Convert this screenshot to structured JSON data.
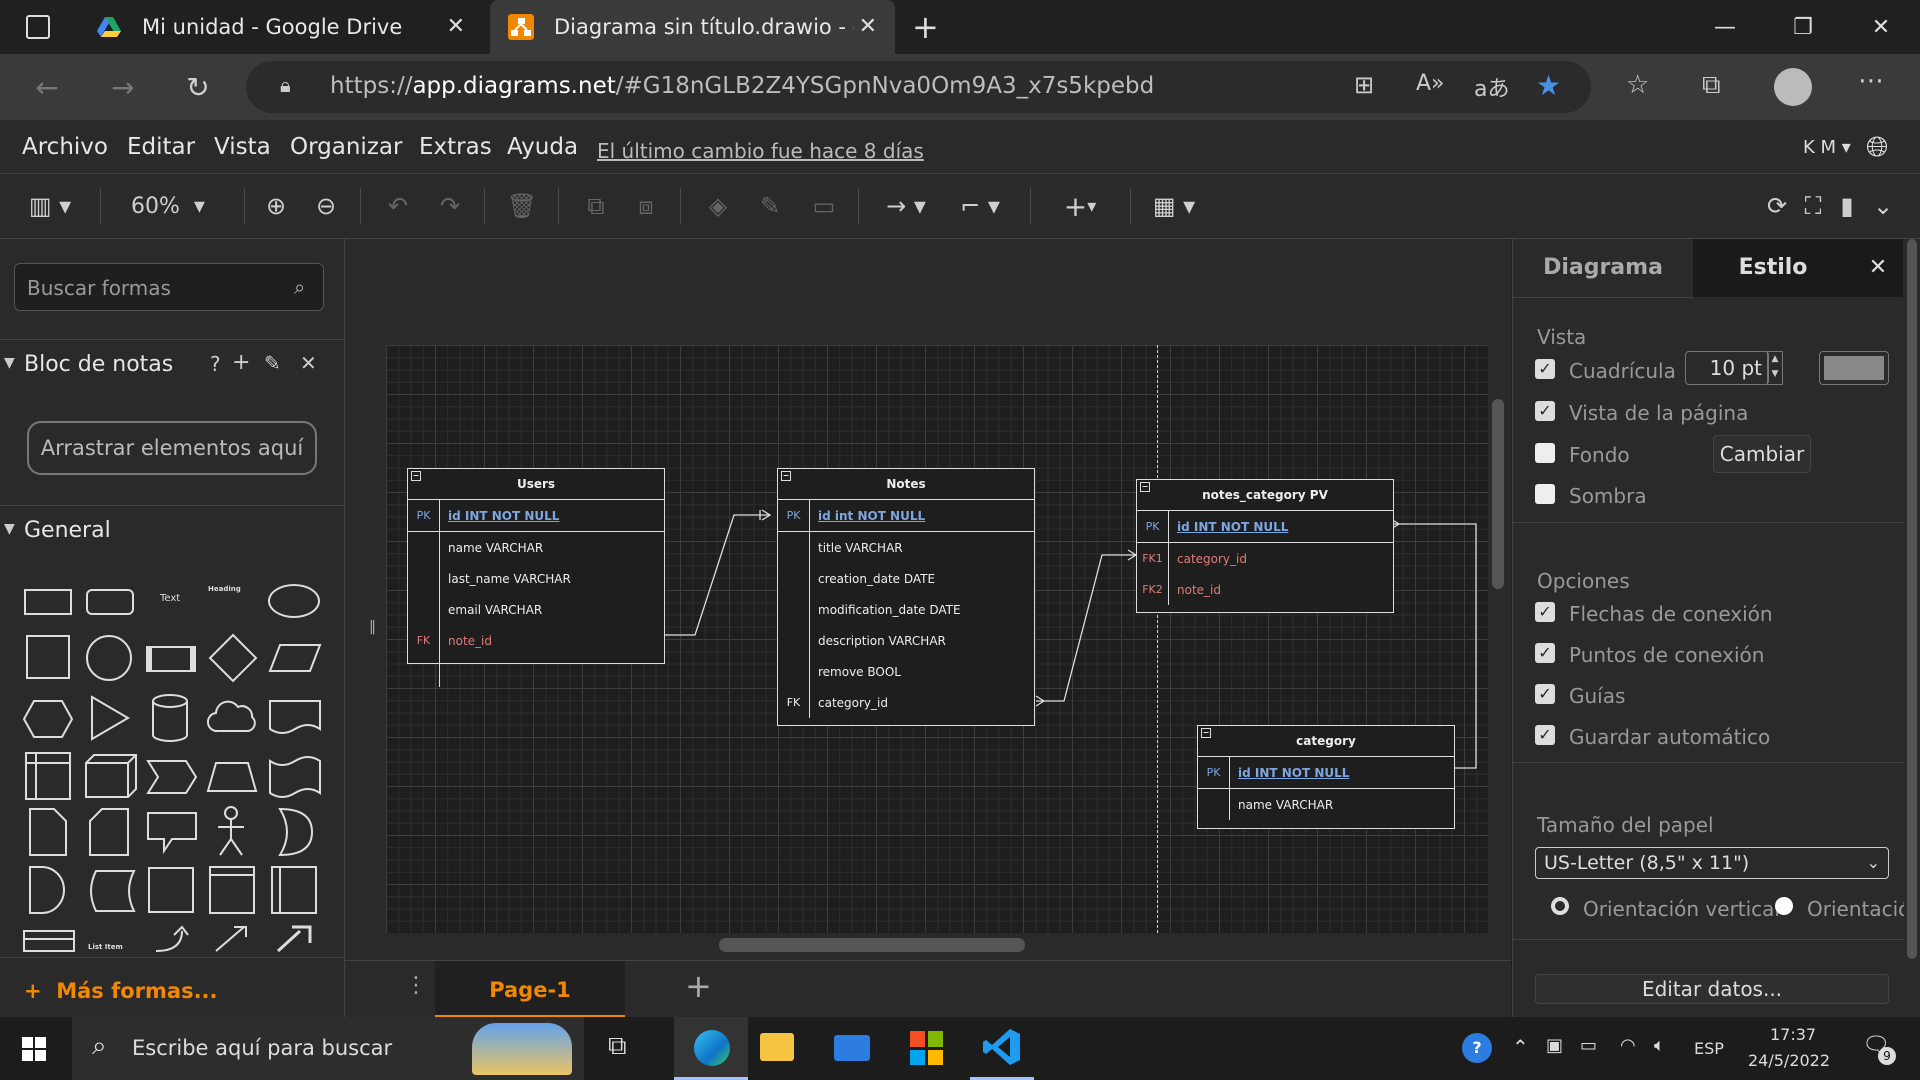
{
  "browser": {
    "tabs": [
      {
        "title": "Mi unidad - Google Drive",
        "icon": "google-drive-icon",
        "active": false
      },
      {
        "title": "Diagrama sin título.drawio - diag",
        "icon": "drawio-icon",
        "active": true
      }
    ],
    "url_prefix": "https://",
    "url_host": "app.diagrams.net",
    "url_rest": "/#G18nGLB2Z4YSGpnNva0Om9A3_x7s5kpebd"
  },
  "menu": {
    "items": [
      "Archivo",
      "Editar",
      "Vista",
      "Organizar",
      "Extras",
      "Ayuda"
    ],
    "last_change": "El último cambio fue hace 8 días",
    "user": "K M"
  },
  "toolbar": {
    "zoom": "60%"
  },
  "left_panel": {
    "search_placeholder": "Buscar formas",
    "scratchpad_title": "Bloc de notas",
    "scratchpad_help": "?",
    "drop_here": "Arrastrar elementos aquí",
    "general_title": "General",
    "shape_text": "Text",
    "shape_heading": "Heading",
    "list_item": "List Item",
    "more_shapes": "Más formas..."
  },
  "diagram": {
    "tables": [
      {
        "name": "Users",
        "rows": [
          {
            "key": "PK",
            "field": "id INT NOT NULL",
            "type": "pk"
          },
          {
            "key": "",
            "field": "name VARCHAR",
            "type": "normal"
          },
          {
            "key": "",
            "field": "last_name VARCHAR",
            "type": "normal"
          },
          {
            "key": "",
            "field": "email VARCHAR",
            "type": "normal"
          },
          {
            "key": "FK",
            "field": "note_id",
            "type": "fk"
          }
        ]
      },
      {
        "name": "Notes",
        "rows": [
          {
            "key": "PK",
            "field": "id int NOT NULL",
            "type": "pk"
          },
          {
            "key": "",
            "field": "title VARCHAR",
            "type": "normal"
          },
          {
            "key": "",
            "field": "creation_date DATE",
            "type": "normal"
          },
          {
            "key": "",
            "field": "modification_date DATE",
            "type": "normal"
          },
          {
            "key": "",
            "field": "description VARCHAR",
            "type": "normal"
          },
          {
            "key": "",
            "field": "remove BOOL",
            "type": "normal"
          },
          {
            "key": "FK",
            "field": "category_id",
            "type": "normal"
          }
        ]
      },
      {
        "name": "notes_category PV",
        "rows": [
          {
            "key": "PK",
            "field": "id INT NOT NULL",
            "type": "pk"
          },
          {
            "key": "FK1",
            "field": "category_id",
            "type": "fk"
          },
          {
            "key": "FK2",
            "field": "note_id",
            "type": "fk"
          }
        ]
      },
      {
        "name": "category",
        "rows": [
          {
            "key": "PK",
            "field": "id INT NOT NULL",
            "type": "pk"
          },
          {
            "key": "",
            "field": "name VARCHAR",
            "type": "normal"
          }
        ]
      }
    ]
  },
  "right_panel": {
    "tab_diagram": "Diagrama",
    "tab_style": "Estilo",
    "view_title": "Vista",
    "grid": {
      "label": "Cuadrícula",
      "checked": true,
      "size": "10 pt"
    },
    "page_view": {
      "label": "Vista de la página",
      "checked": true
    },
    "background": {
      "label": "Fondo",
      "checked": false,
      "button": "Cambiar"
    },
    "shadow": {
      "label": "Sombra",
      "checked": false
    },
    "options_title": "Opciones",
    "options": [
      {
        "label": "Flechas de conexión",
        "checked": true
      },
      {
        "label": "Puntos de conexión",
        "checked": true
      },
      {
        "label": "Guías",
        "checked": true
      },
      {
        "label": "Guardar automático",
        "checked": true
      }
    ],
    "paper_title": "Tamaño del papel",
    "paper_size": "US-Letter (8,5\" x 11\")",
    "orientation_vertical": "Orientación vertical",
    "orientation_horizontal": "Orientació",
    "edit_data": "Editar datos..."
  },
  "pages": {
    "current": "Page-1"
  },
  "taskbar": {
    "search_placeholder": "Escribe aquí para buscar",
    "language": "ESP",
    "time": "17:37",
    "date": "24/5/2022",
    "notifications": "9"
  },
  "colors": {
    "accent": "#f08705",
    "pk_blue": "#7ea6e0",
    "fk_red": "#e07b7b"
  }
}
